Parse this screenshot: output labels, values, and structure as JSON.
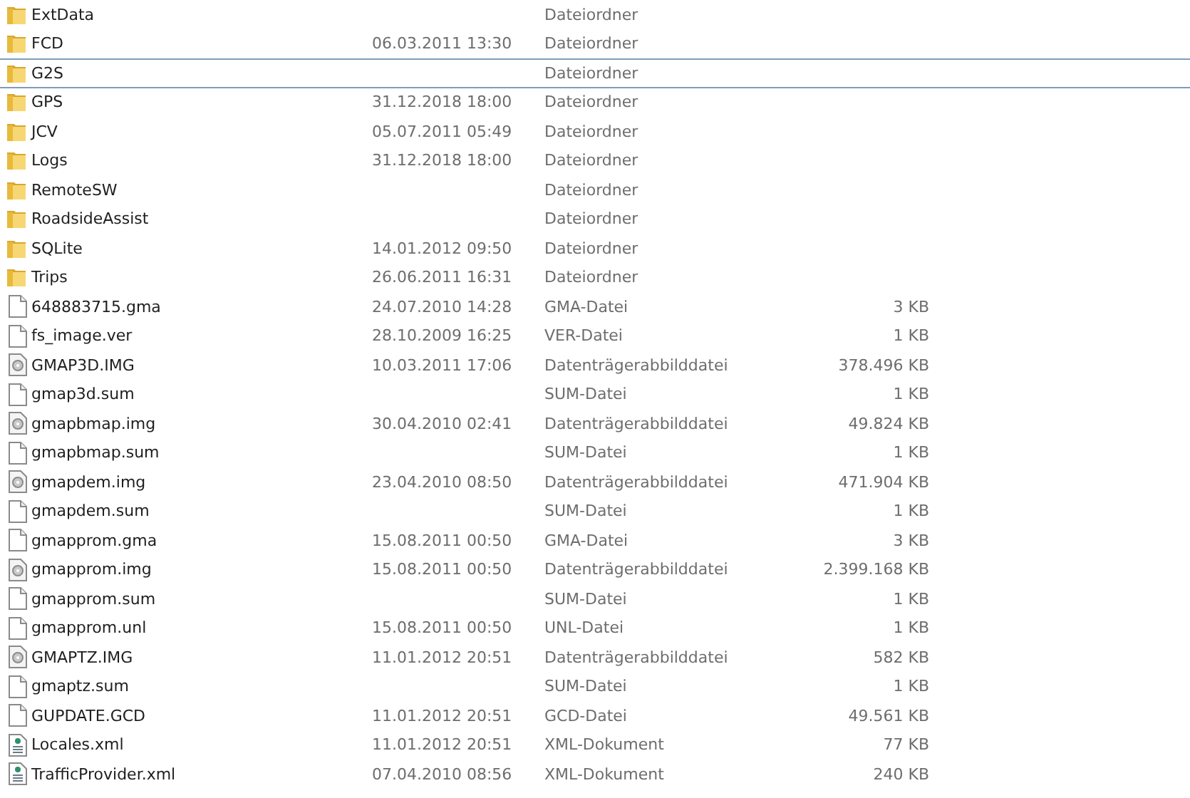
{
  "rows": [
    {
      "kind": "folder",
      "name": "ExtData",
      "date": "",
      "type": "Dateiordner",
      "size": "",
      "focused": false
    },
    {
      "kind": "folder",
      "name": "FCD",
      "date": "06.03.2011 13:30",
      "type": "Dateiordner",
      "size": "",
      "focused": false
    },
    {
      "kind": "folder",
      "name": "G2S",
      "date": "",
      "type": "Dateiordner",
      "size": "",
      "focused": true
    },
    {
      "kind": "folder",
      "name": "GPS",
      "date": "31.12.2018 18:00",
      "type": "Dateiordner",
      "size": "",
      "focused": false
    },
    {
      "kind": "folder",
      "name": "JCV",
      "date": "05.07.2011 05:49",
      "type": "Dateiordner",
      "size": "",
      "focused": false
    },
    {
      "kind": "folder",
      "name": "Logs",
      "date": "31.12.2018 18:00",
      "type": "Dateiordner",
      "size": "",
      "focused": false
    },
    {
      "kind": "folder",
      "name": "RemoteSW",
      "date": "",
      "type": "Dateiordner",
      "size": "",
      "focused": false
    },
    {
      "kind": "folder",
      "name": "RoadsideAssist",
      "date": "",
      "type": "Dateiordner",
      "size": "",
      "focused": false
    },
    {
      "kind": "folder",
      "name": "SQLite",
      "date": "14.01.2012 09:50",
      "type": "Dateiordner",
      "size": "",
      "focused": false
    },
    {
      "kind": "folder",
      "name": "Trips",
      "date": "26.06.2011 16:31",
      "type": "Dateiordner",
      "size": "",
      "focused": false
    },
    {
      "kind": "file",
      "name": "648883715.gma",
      "date": "24.07.2010 14:28",
      "type": "GMA-Datei",
      "size": "3 KB",
      "focused": false
    },
    {
      "kind": "file",
      "name": "fs_image.ver",
      "date": "28.10.2009 16:25",
      "type": "VER-Datei",
      "size": "1 KB",
      "focused": false
    },
    {
      "kind": "image",
      "name": "GMAP3D.IMG",
      "date": "10.03.2011 17:06",
      "type": "Datenträgerabbilddatei",
      "size": "378.496 KB",
      "focused": false
    },
    {
      "kind": "file",
      "name": "gmap3d.sum",
      "date": "",
      "type": "SUM-Datei",
      "size": "1 KB",
      "focused": false
    },
    {
      "kind": "image",
      "name": "gmapbmap.img",
      "date": "30.04.2010 02:41",
      "type": "Datenträgerabbilddatei",
      "size": "49.824 KB",
      "focused": false
    },
    {
      "kind": "file",
      "name": "gmapbmap.sum",
      "date": "",
      "type": "SUM-Datei",
      "size": "1 KB",
      "focused": false
    },
    {
      "kind": "image",
      "name": "gmapdem.img",
      "date": "23.04.2010 08:50",
      "type": "Datenträgerabbilddatei",
      "size": "471.904 KB",
      "focused": false
    },
    {
      "kind": "file",
      "name": "gmapdem.sum",
      "date": "",
      "type": "SUM-Datei",
      "size": "1 KB",
      "focused": false
    },
    {
      "kind": "file",
      "name": "gmapprom.gma",
      "date": "15.08.2011 00:50",
      "type": "GMA-Datei",
      "size": "3 KB",
      "focused": false
    },
    {
      "kind": "image",
      "name": "gmapprom.img",
      "date": "15.08.2011 00:50",
      "type": "Datenträgerabbilddatei",
      "size": "2.399.168 KB",
      "focused": false
    },
    {
      "kind": "file",
      "name": "gmapprom.sum",
      "date": "",
      "type": "SUM-Datei",
      "size": "1 KB",
      "focused": false
    },
    {
      "kind": "file",
      "name": "gmapprom.unl",
      "date": "15.08.2011 00:50",
      "type": "UNL-Datei",
      "size": "1 KB",
      "focused": false
    },
    {
      "kind": "image",
      "name": "GMAPTZ.IMG",
      "date": "11.01.2012 20:51",
      "type": "Datenträgerabbilddatei",
      "size": "582 KB",
      "focused": false
    },
    {
      "kind": "file",
      "name": "gmaptz.sum",
      "date": "",
      "type": "SUM-Datei",
      "size": "1 KB",
      "focused": false
    },
    {
      "kind": "file",
      "name": "GUPDATE.GCD",
      "date": "11.01.2012 20:51",
      "type": "GCD-Datei",
      "size": "49.561 KB",
      "focused": false
    },
    {
      "kind": "xml",
      "name": "Locales.xml",
      "date": "11.01.2012 20:51",
      "type": "XML-Dokument",
      "size": "77 KB",
      "focused": false
    },
    {
      "kind": "xml",
      "name": "TrafficProvider.xml",
      "date": "07.04.2010 08:56",
      "type": "XML-Dokument",
      "size": "240 KB",
      "focused": false
    }
  ]
}
